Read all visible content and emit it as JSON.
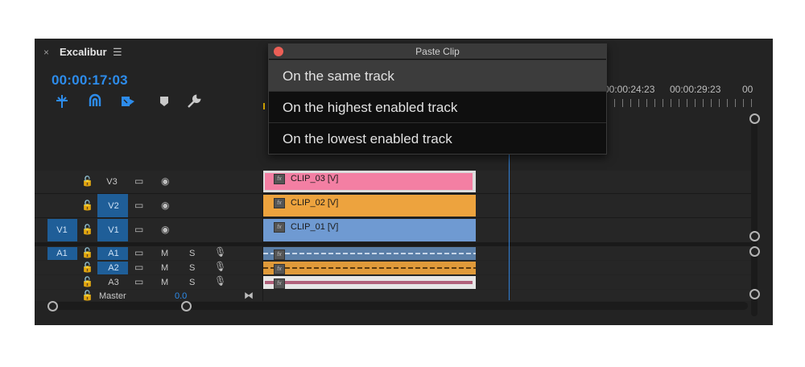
{
  "panel": {
    "close_glyph": "×",
    "title": "Excalibur",
    "menu_glyph": "☰",
    "timecode": "00:00:17:03",
    "tools": [
      "snap-icon",
      "linked-selection-icon",
      "insert-overwrite-icon",
      "marker-icon",
      "wrench-icon"
    ]
  },
  "ruler": {
    "times": [
      "00:00:24:23",
      "00:00:29:23",
      "00"
    ]
  },
  "dialog": {
    "title": "Paste Clip",
    "options": [
      "On the same track",
      "On the highest enabled track",
      "On the lowest enabled track"
    ],
    "selected_index": 0
  },
  "video_tracks": [
    {
      "label": "V3",
      "source": "",
      "clip": "CLIP_03 [V]",
      "color": "#f37fa3"
    },
    {
      "label": "V2",
      "source": "",
      "clip": "CLIP_02 [V]",
      "color": "#eda33e"
    },
    {
      "label": "V1",
      "source": "V1",
      "clip": "CLIP_01 [V]",
      "color": "#6f9ad2"
    }
  ],
  "audio_tracks": [
    {
      "label": "A1",
      "source": "A1",
      "m": "M",
      "s": "S",
      "color": "#5b7fa8"
    },
    {
      "label": "A2",
      "source": "",
      "m": "M",
      "s": "S",
      "color": "#e09a3a"
    },
    {
      "label": "A3",
      "source": "",
      "m": "M",
      "s": "S",
      "color": "#b0607a"
    }
  ],
  "master": {
    "label": "Master",
    "value": "0.0"
  },
  "glyphs": {
    "lock": "🔓",
    "eye": "◉",
    "film": "▭",
    "mic": "🎙",
    "fx": "fx",
    "end": "⧓"
  }
}
